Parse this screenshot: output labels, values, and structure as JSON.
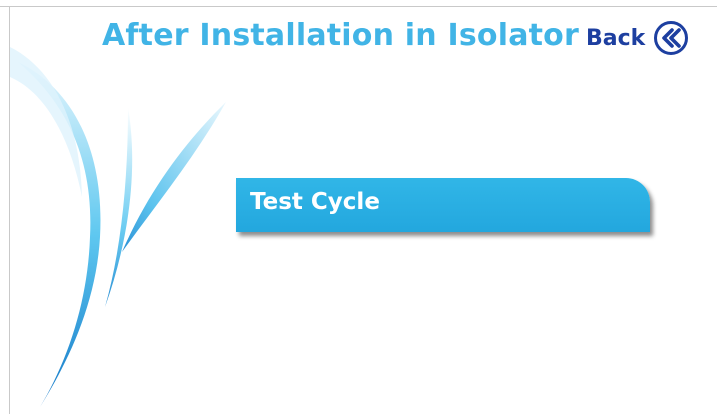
{
  "header": {
    "title": "After Installation in Isolator",
    "back_label": "Back",
    "back_icon": "double-chevron-left-icon"
  },
  "menu": {
    "items": [
      {
        "label": "Test Cycle"
      }
    ]
  },
  "colors": {
    "title": "#41b4e6",
    "back": "#1d3fa0",
    "button": "#26a9e0",
    "button_text": "#ffffff",
    "swoosh": "#29b6ea"
  }
}
